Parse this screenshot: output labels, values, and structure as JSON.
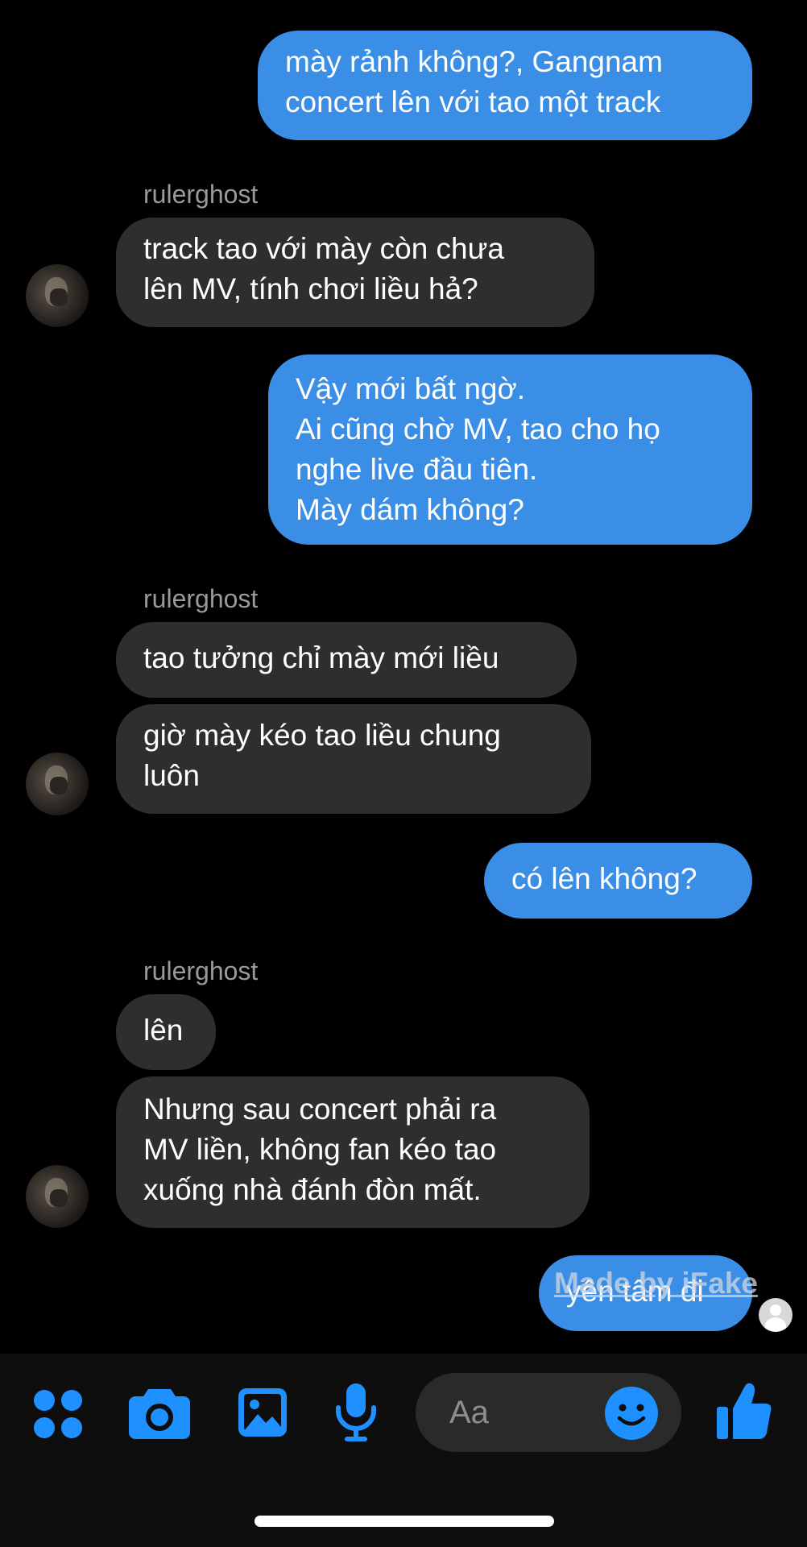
{
  "colors": {
    "background": "#000000",
    "outgoing_bubble": "#3b8ee6",
    "incoming_bubble": "#2e2e2e",
    "accent": "#1e90ff"
  },
  "messages": [
    {
      "direction": "outgoing",
      "text": "mày rảnh không?, Gangnam\nconcert lên với tao một track"
    },
    {
      "sender": "rulerghost"
    },
    {
      "direction": "incoming",
      "text": "track tao với mày còn chưa\nlên MV, tính chơi liều hả?"
    },
    {
      "direction": "outgoing",
      "text": "Vậy mới bất ngờ.\nAi cũng chờ MV, tao cho họ\nnghe live đầu tiên.\nMày dám không?"
    },
    {
      "sender": "rulerghost"
    },
    {
      "direction": "incoming",
      "text": "tao tưởng chỉ mày mới liều"
    },
    {
      "direction": "incoming",
      "text": "giờ mày kéo tao liều chung\nluôn"
    },
    {
      "direction": "outgoing",
      "text": "có lên không?"
    },
    {
      "sender": "rulerghost"
    },
    {
      "direction": "incoming",
      "text": "lên"
    },
    {
      "direction": "incoming",
      "text": "Nhưng sau concert phải ra\nMV liền, không fan kéo tao\nxuống nhà đánh đòn mất."
    },
    {
      "direction": "outgoing",
      "text": "yên tâm đi"
    }
  ],
  "watermark": "Made by iFake",
  "composer": {
    "placeholder": "Aa",
    "icons": [
      "apps-icon",
      "camera-icon",
      "gallery-icon",
      "microphone-icon",
      "emoji-icon",
      "thumbs-up-icon"
    ]
  }
}
